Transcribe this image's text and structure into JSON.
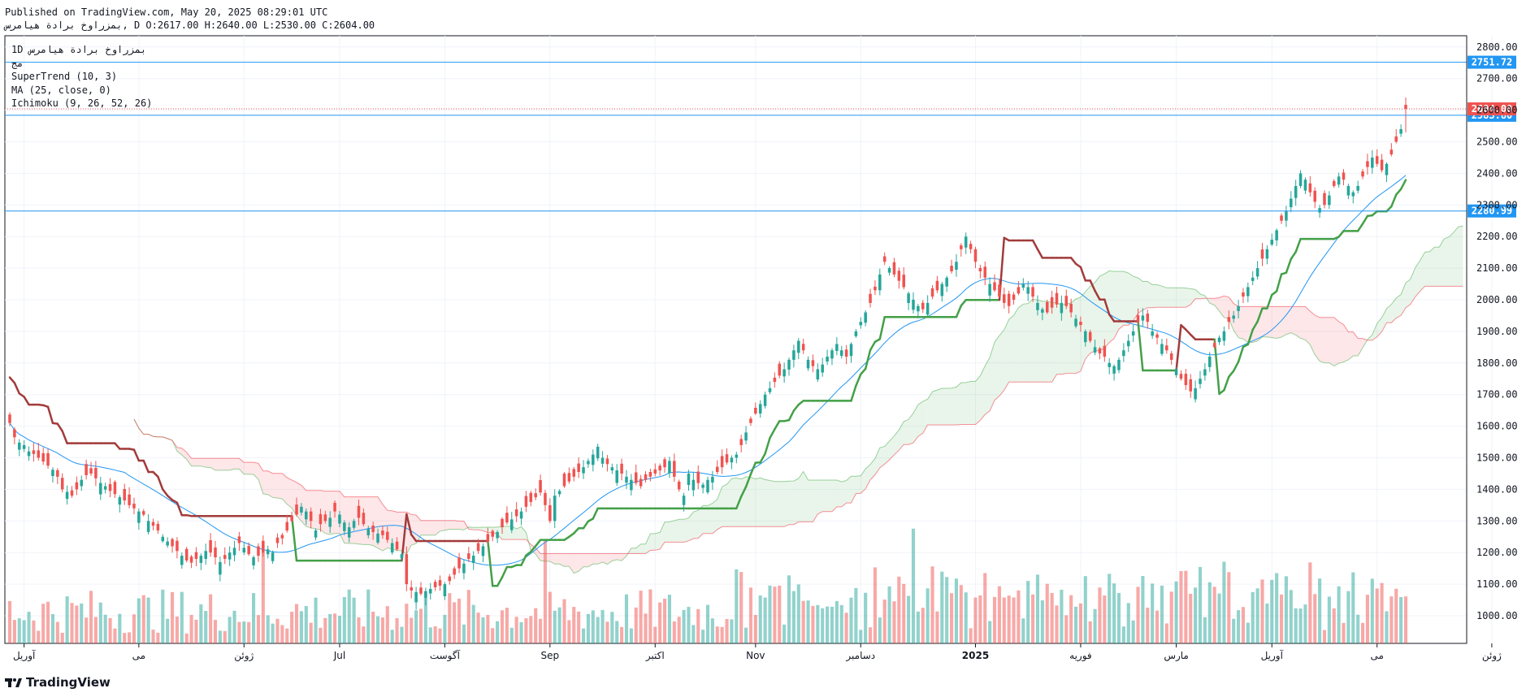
{
  "header": {
    "published": "Published on TradingView.com, May 20, 2025 08:29:01 UTC",
    "ohlc_line": "بمزراوخ برادة هیامرس, D O:2617.00 H:2640.00 L:2530.00 C:2604.00"
  },
  "legend": {
    "symbol": "1D بمزراوخ برادة هیامرس",
    "sub": "مج",
    "supertrend": "SuperTrend (10, 3)",
    "ma": "MA (25, close, 0)",
    "ichimoku": "Ichimoku (9, 26, 52, 26)"
  },
  "logo": {
    "text": "TradingView"
  },
  "chart_data": {
    "type": "candlestick",
    "y_ticks": [
      1000,
      1100,
      1200,
      1300,
      1400,
      1500,
      1600,
      1700,
      1800,
      1900,
      2000,
      2100,
      2200,
      2300,
      2400,
      2500,
      2600,
      2700,
      2800
    ],
    "y_tick_labels": [
      "1000.00",
      "1100.00",
      "1200.00",
      "1300.00",
      "1400.00",
      "1500.00",
      "1600.00",
      "1700.00",
      "1800.00",
      "1900.00",
      "2000.00",
      "2100.00",
      "2200.00",
      "2300.00",
      "2400.00",
      "2500.00",
      "2600.00",
      "2700.00",
      "2800.00"
    ],
    "x_labels": [
      {
        "label": "آوریل",
        "i": 3
      },
      {
        "label": "می",
        "i": 27
      },
      {
        "label": "ژوئن",
        "i": 49
      },
      {
        "label": "Jul",
        "i": 69
      },
      {
        "label": "آگوست",
        "i": 91
      },
      {
        "label": "Sep",
        "i": 113
      },
      {
        "label": "اکتبر",
        "i": 135
      },
      {
        "label": "Nov",
        "i": 156
      },
      {
        "label": "دسامبر",
        "i": 178
      },
      {
        "label": "2025",
        "i": 202,
        "bold": true
      },
      {
        "label": "فوریه",
        "i": 224
      },
      {
        "label": "مارس",
        "i": 244
      },
      {
        "label": "آوریل",
        "i": 264
      },
      {
        "label": "می",
        "i": 286
      },
      {
        "label": "ژوئن",
        "i": 310
      }
    ],
    "last_close": 2604.0,
    "horizontal_lines": [
      {
        "price": 2751.72,
        "label": "2751.72",
        "color": "#2196f3"
      },
      {
        "price": 2583.8,
        "label": "2583.80",
        "color": "#2196f3"
      },
      {
        "price": 2280.99,
        "label": "2280.99",
        "color": "#2196f3"
      }
    ],
    "last_price_label": "2604.00",
    "closes": [
      1610,
      1565,
      1548,
      1540,
      1520,
      1512,
      1500,
      1488,
      1475,
      1462,
      1440,
      1400,
      1392,
      1380,
      1400,
      1430,
      1445,
      1450,
      1435,
      1420,
      1410,
      1395,
      1385,
      1375,
      1365,
      1350,
      1340,
      1330,
      1320,
      1300,
      1285,
      1270,
      1250,
      1235,
      1220,
      1205,
      1190,
      1175,
      1168,
      1180,
      1190,
      1205,
      1200,
      1185,
      1170,
      1180,
      1200,
      1215,
      1230,
      1215,
      1195,
      1185,
      1190,
      1200,
      1210,
      1200,
      1230,
      1245,
      1270,
      1300,
      1320,
      1345,
      1330,
      1300,
      1270,
      1290,
      1300,
      1310,
      1330,
      1320,
      1295,
      1280,
      1300,
      1310,
      1290,
      1275,
      1265,
      1260,
      1255,
      1240,
      1230,
      1210,
      1195,
      1100,
      1080,
      1075,
      1070,
      1078,
      1085,
      1090,
      1095,
      1100,
      1110,
      1130,
      1150,
      1165,
      1180,
      1190,
      1205,
      1220,
      1235,
      1250,
      1265,
      1280,
      1295,
      1305,
      1315,
      1330,
      1345,
      1360,
      1375,
      1390,
      1350,
      1300,
      1380,
      1395,
      1410,
      1425,
      1440,
      1455,
      1470,
      1490,
      1510,
      1535,
      1500,
      1480,
      1470,
      1460,
      1450,
      1440,
      1430,
      1420,
      1410,
      1430,
      1440,
      1450,
      1460,
      1470,
      1490,
      1440,
      1400,
      1380,
      1450,
      1430,
      1420,
      1415,
      1430,
      1440,
      1455,
      1470,
      1485,
      1500,
      1510,
      1540,
      1580,
      1610,
      1640,
      1670,
      1700,
      1720,
      1740,
      1760,
      1780,
      1810,
      1840,
      1870,
      1840,
      1810,
      1790,
      1780,
      1795,
      1820,
      1840,
      1860,
      1840,
      1820,
      1860,
      1900,
      1930,
      1960,
      1990,
      2030,
      2080,
      2120,
      2100,
      2080,
      2060,
      2040,
      2020,
      2000,
      1980,
      1970,
      1990,
      2010,
      2030,
      2050,
      2070,
      2090,
      2120,
      2160,
      2200,
      2160,
      2120,
      2090,
      2070,
      2050,
      2030,
      2010,
      1990,
      1980,
      2000,
      2020,
      2050,
      2040,
      2010,
      1990,
      1970,
      1960,
      1975,
      1985,
      1990,
      1980,
      1960,
      1940,
      1920,
      1900,
      1870,
      1850,
      1830,
      1820,
      1800,
      1790,
      1810,
      1840,
      1870,
      1900,
      1930,
      1950,
      1930,
      1900,
      1880,
      1860,
      1840,
      1810,
      1780,
      1750,
      1730,
      1710,
      1720,
      1750,
      1780,
      1820,
      1850,
      1880,
      1900,
      1930,
      1950,
      1980,
      2010,
      2040,
      2070,
      2100,
      2130,
      2160,
      2190,
      2220,
      2250,
      2280,
      2320,
      2360,
      2400,
      2380,
      2340,
      2310,
      2290,
      2300,
      2330,
      2360,
      2390,
      2380,
      2360,
      2340,
      2360,
      2390,
      2420,
      2450,
      2430,
      2410,
      2430,
      2460,
      2500,
      2540,
      2604
    ]
  }
}
